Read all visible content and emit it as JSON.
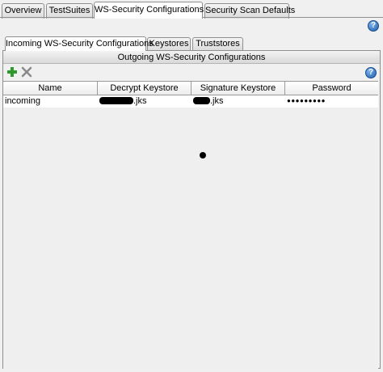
{
  "top_tabs": [
    {
      "label": "Overview"
    },
    {
      "label": "TestSuites"
    },
    {
      "label": "WS-Security Configurations"
    },
    {
      "label": "Security Scan Defaults"
    }
  ],
  "inner_tabs": [
    {
      "label": "Incoming WS-Security Configurations"
    },
    {
      "label": "Keystores"
    },
    {
      "label": "Truststores"
    }
  ],
  "help_icon": "?",
  "section_title": "Outgoing WS-Security Configurations",
  "toolbar": {
    "add_icon": "add-icon",
    "remove_icon": "remove-icon"
  },
  "table": {
    "columns": [
      "Name",
      "Decrypt Keystore",
      "Signature Keystore",
      "Password"
    ],
    "rows": [
      {
        "name": "incoming",
        "decrypt_keystore_suffix": ".jks",
        "signature_keystore_suffix": ".jks",
        "password": "●●●●●●●●●"
      }
    ]
  },
  "colors": {
    "add_green": "#2e9a2e",
    "remove_gray": "#8a8a8a",
    "help_blue": "#1f5fb0"
  }
}
